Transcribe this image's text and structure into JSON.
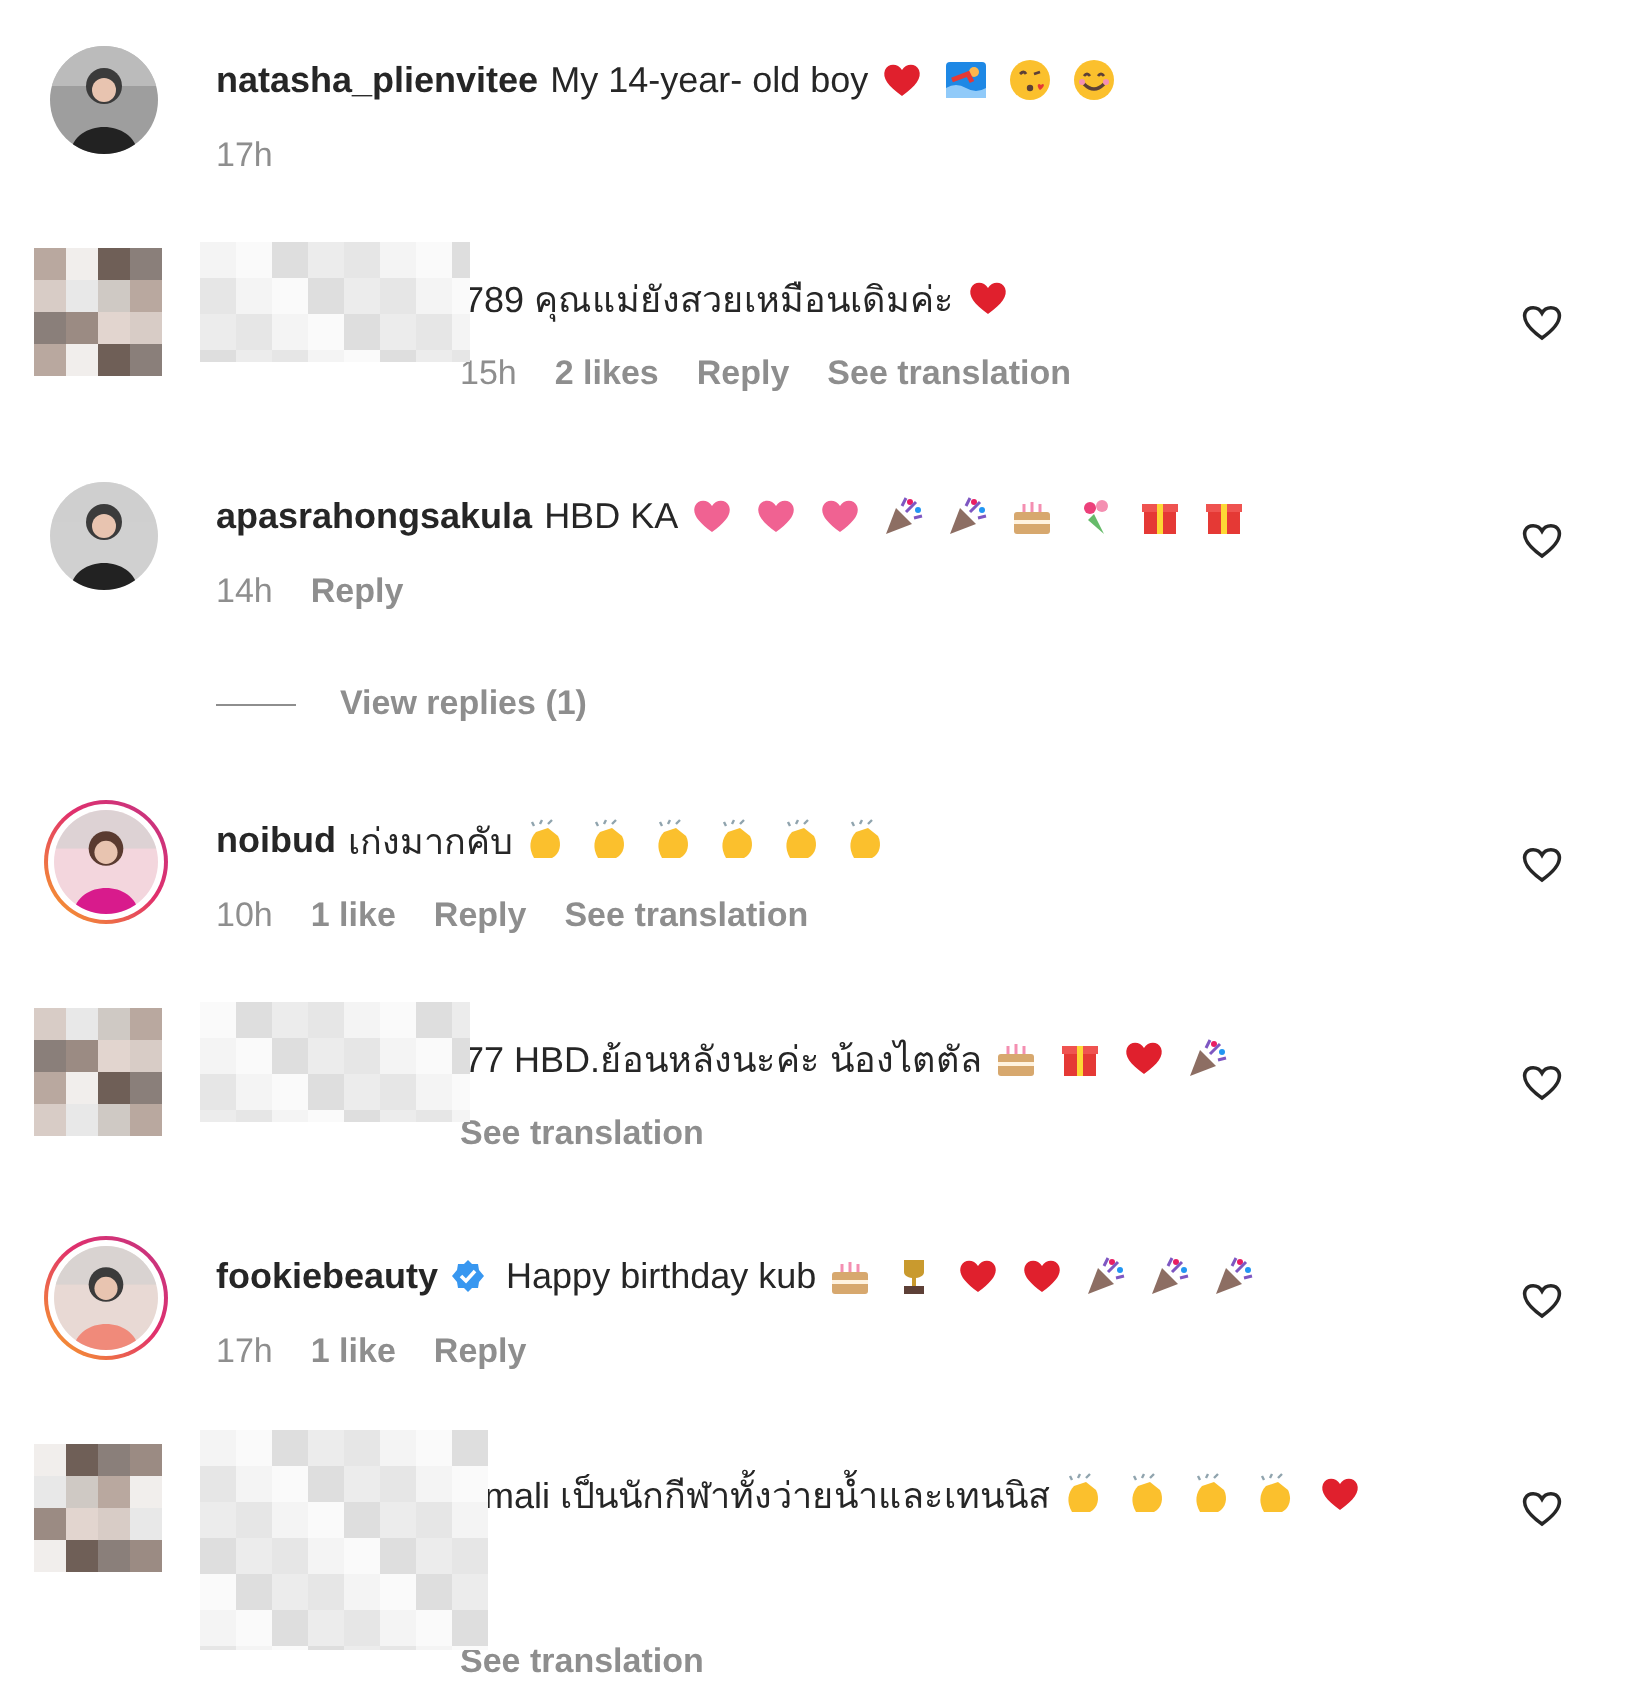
{
  "comments": [
    {
      "kind": "author",
      "username": "natasha_plienvitee",
      "verified": false,
      "story_ring": false,
      "text": "My 14-year- old boy",
      "emojis": [
        {
          "kind": "heart"
        },
        {
          "kind": "wave"
        },
        {
          "kind": "kiss"
        },
        {
          "kind": "smile"
        }
      ],
      "meta": [
        {
          "kind": "time",
          "text": "17h"
        }
      ],
      "like_button": false
    },
    {
      "kind": "redacted",
      "text": "789 คุณแม่ยังสวยเหมือนเดิมค่ะ",
      "emojis": [
        {
          "kind": "heart"
        }
      ],
      "meta": [
        {
          "kind": "time",
          "text": "15h"
        },
        {
          "kind": "likes",
          "text": "2 likes"
        },
        {
          "kind": "reply",
          "text": "Reply"
        },
        {
          "kind": "translate",
          "text": "See translation"
        }
      ],
      "like_button": true
    },
    {
      "kind": "normal",
      "username": "apasrahongsakula",
      "verified": false,
      "story_ring": false,
      "text": "HBD KA",
      "emojis": [
        {
          "kind": "pink-heart"
        },
        {
          "kind": "pink-heart"
        },
        {
          "kind": "pink-heart"
        },
        {
          "kind": "party"
        },
        {
          "kind": "party"
        },
        {
          "kind": "cake"
        },
        {
          "kind": "bouquet"
        },
        {
          "kind": "gift"
        },
        {
          "kind": "gift"
        }
      ],
      "meta": [
        {
          "kind": "time",
          "text": "14h"
        },
        {
          "kind": "reply",
          "text": "Reply"
        }
      ],
      "like_button": true,
      "view_replies": "View replies (1)"
    },
    {
      "kind": "normal",
      "username": "noibud",
      "verified": false,
      "story_ring": true,
      "text": "เก่งมากคับ",
      "emojis": [
        {
          "kind": "clap"
        },
        {
          "kind": "clap"
        },
        {
          "kind": "clap"
        },
        {
          "kind": "clap"
        },
        {
          "kind": "clap"
        },
        {
          "kind": "clap"
        }
      ],
      "meta": [
        {
          "kind": "time",
          "text": "10h"
        },
        {
          "kind": "likes",
          "text": "1 like"
        },
        {
          "kind": "reply",
          "text": "Reply"
        },
        {
          "kind": "translate",
          "text": "See translation"
        }
      ],
      "like_button": true
    },
    {
      "kind": "redacted",
      "text": "77 HBD.ย้อนหลังนะค่ะ น้องไตตัล",
      "emojis": [
        {
          "kind": "cake"
        },
        {
          "kind": "gift"
        },
        {
          "kind": "heart"
        },
        {
          "kind": "party"
        }
      ],
      "meta": [
        {
          "kind": "translate",
          "text": "See translation"
        }
      ],
      "like_button": true
    },
    {
      "kind": "normal",
      "username": "fookiebeauty",
      "verified": true,
      "story_ring": true,
      "text": "Happy birthday kub",
      "emojis": [
        {
          "kind": "cake"
        },
        {
          "kind": "trophy"
        },
        {
          "kind": "heart"
        },
        {
          "kind": "heart"
        },
        {
          "kind": "party"
        },
        {
          "kind": "party"
        },
        {
          "kind": "party"
        }
      ],
      "meta": [
        {
          "kind": "time",
          "text": "17h"
        },
        {
          "kind": "likes",
          "text": "1 like"
        },
        {
          "kind": "reply",
          "text": "Reply"
        }
      ],
      "like_button": true
    },
    {
      "kind": "redacted-tall",
      "text": "mali เป็นนักกีฬาทั้งว่ายน้ำและเทนนิส",
      "emojis": [
        {
          "kind": "clap"
        },
        {
          "kind": "clap"
        },
        {
          "kind": "clap"
        },
        {
          "kind": "clap"
        },
        {
          "kind": "heart"
        }
      ],
      "meta": [
        {
          "kind": "translate",
          "text": "See translation"
        }
      ],
      "like_button": true
    }
  ]
}
